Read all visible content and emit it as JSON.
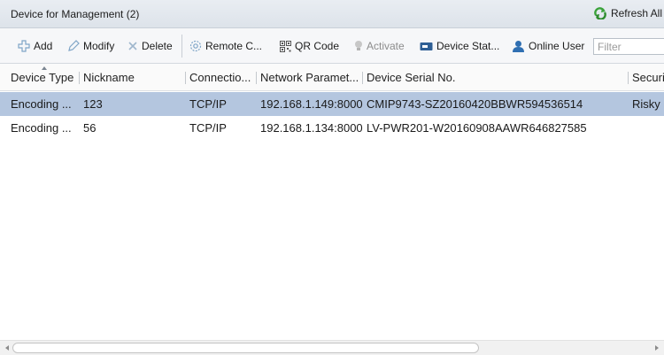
{
  "panel": {
    "title": "Device for Management (2)",
    "refresh_label": "Refresh All"
  },
  "toolbar": {
    "add": "Add",
    "modify": "Modify",
    "delete": "Delete",
    "remote_config": "Remote C...",
    "qr_code": "QR Code",
    "activate": "Activate",
    "device_status": "Device Stat...",
    "online_user": "Online User",
    "filter_placeholder": "Filter"
  },
  "table": {
    "columns": [
      "Device Type",
      "Nickname",
      "Connectio...",
      "Network Paramet...",
      "Device Serial No.",
      "Securi"
    ],
    "rows": [
      [
        "Encoding ...",
        "123",
        "TCP/IP",
        "192.168.1.149:8000",
        "CMIP9743-SZ20160420BBWR594536514",
        "Risky"
      ],
      [
        "Encoding ...",
        "56",
        "TCP/IP",
        "192.168.1.134:8000",
        "LV-PWR201-W20160908AAWR646827585",
        ""
      ]
    ],
    "selected_row": 0,
    "sort_column": "Device Type"
  },
  "icons": {
    "refresh": "refresh-icon",
    "add": "plus-icon",
    "modify": "pencil-icon",
    "delete": "delete-icon",
    "remote_config": "gear-icon",
    "qr_code": "qr-code-icon",
    "activate": "bulb-icon",
    "device_status": "device-status-icon",
    "online_user": "user-icon"
  },
  "colors": {
    "selected_row": "#b4c6df",
    "title_bar": "#e4e9ee",
    "refresh_green": "#3aa33a"
  }
}
